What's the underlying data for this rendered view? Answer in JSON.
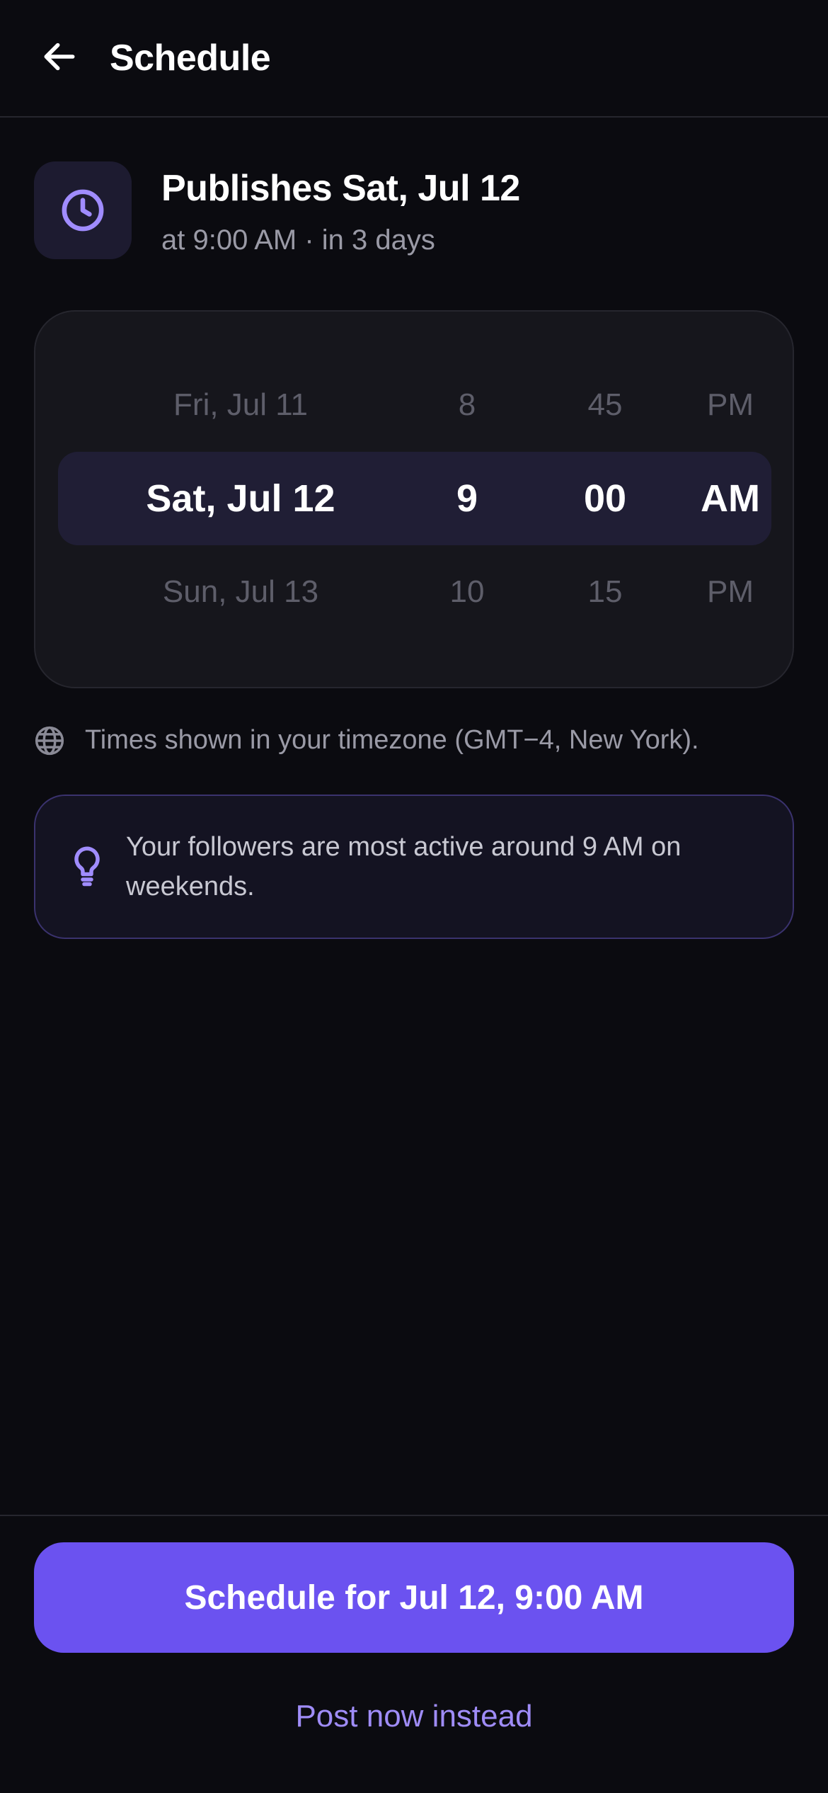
{
  "header": {
    "back_icon": "arrow-left-icon",
    "title": "Schedule"
  },
  "summary": {
    "icon": "clock-icon",
    "title": "Publishes Sat, Jul 12",
    "subtitle": "at 9:00 AM · in 3 days"
  },
  "picker": {
    "previous": {
      "date": "Fri, Jul 11",
      "hour": "8",
      "minute": "45",
      "period": "PM"
    },
    "selected": {
      "date": "Sat, Jul 12",
      "hour": "9",
      "minute": "00",
      "period": "AM"
    },
    "next": {
      "date": "Sun, Jul 13",
      "hour": "10",
      "minute": "15",
      "period": "PM"
    }
  },
  "timezone": {
    "icon": "globe-icon",
    "text": "Times shown in your timezone (GMT−4, New York)."
  },
  "tip": {
    "icon": "lightbulb-icon",
    "text": "Your followers are most active around 9 AM on weekends."
  },
  "actions": {
    "primary_label": "Schedule for Jul 12, 9:00 AM",
    "secondary_label": "Post now instead"
  },
  "colors": {
    "background": "#0b0b10",
    "accent": "#6b52f0",
    "accent_light": "#9f8cf7",
    "muted_text": "#9a9aa6"
  }
}
